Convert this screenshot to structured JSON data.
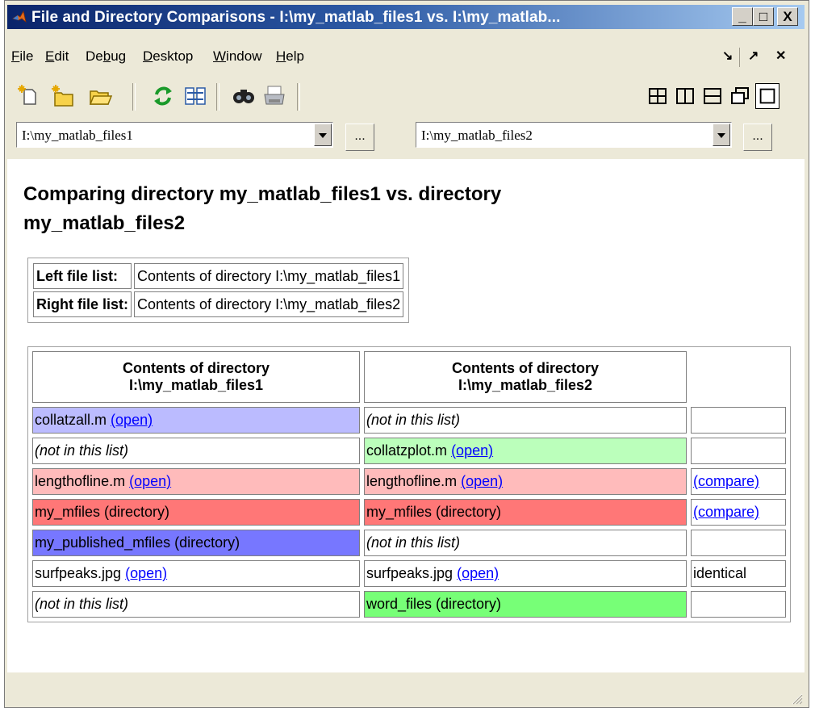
{
  "window": {
    "title": "File and Directory Comparisons - I:\\my_matlab_files1 vs. I:\\my_matlab...",
    "controls": [
      "_",
      "□",
      "X"
    ]
  },
  "menu": {
    "items": [
      "File",
      "Edit",
      "Debug",
      "Desktop",
      "Window",
      "Help"
    ],
    "underline_keys": [
      "F",
      "E",
      "b",
      "D",
      "W",
      "H"
    ],
    "dock_glyph": "↘",
    "undock_glyph": "↗",
    "close_glyph": "✕"
  },
  "toolbar": {
    "icons": [
      "new-file-icon",
      "new-folder-icon",
      "open-folder-icon",
      "refresh-icon",
      "swap-sides-icon",
      "find-icon",
      "print-icon"
    ],
    "layout_icons": [
      "tile-grid-icon",
      "tile-columns-icon",
      "tile-rows-icon",
      "float-icon",
      "maximize-icon"
    ]
  },
  "paths": {
    "left": "I:\\my_matlab_files1",
    "right": "I:\\my_matlab_files2",
    "browse_label": "..."
  },
  "report": {
    "heading": "Comparing directory my_matlab_files1 vs. directory my_matlab_files2",
    "legend": [
      {
        "label": "Left file list:",
        "value": "Contents of directory I:\\my_matlab_files1"
      },
      {
        "label": "Right file list:",
        "value": "Contents of directory I:\\my_matlab_files2"
      }
    ],
    "columns": {
      "left_line1": "Contents of directory",
      "left_line2": "I:\\my_matlab_files1",
      "right_line1": "Contents of directory",
      "right_line2": "I:\\my_matlab_files2"
    },
    "rows": [
      {
        "left": "collatzall.m",
        "left_link": "(open)",
        "left_color": "#bbbbff",
        "right": "(not in this list)",
        "right_link": "",
        "right_color": "#ffffff",
        "action": ""
      },
      {
        "left": "(not in this list)",
        "left_link": "",
        "left_color": "#ffffff",
        "right": "collatzplot.m",
        "right_link": "(open)",
        "right_color": "#bbffbb",
        "action": ""
      },
      {
        "left": "lengthofline.m",
        "left_link": "(open)",
        "left_color": "#ffbbbb",
        "right": "lengthofline.m",
        "right_link": "(open)",
        "right_color": "#ffbbbb",
        "action": "(compare)"
      },
      {
        "left": "my_mfiles (directory)",
        "left_link": "",
        "left_color": "#ff7777",
        "right": "my_mfiles (directory)",
        "right_link": "",
        "right_color": "#ff7777",
        "action": "(compare)"
      },
      {
        "left": "my_published_mfiles (directory)",
        "left_link": "",
        "left_color": "#7777ff",
        "right": "(not in this list)",
        "right_link": "",
        "right_color": "#ffffff",
        "action": ""
      },
      {
        "left": "surfpeaks.jpg",
        "left_link": "(open)",
        "left_color": "#ffffff",
        "right": "surfpeaks.jpg",
        "right_link": "(open)",
        "right_color": "#ffffff",
        "action": "identical"
      },
      {
        "left": "(not in this list)",
        "left_link": "",
        "left_color": "#ffffff",
        "right": "word_files (directory)",
        "right_link": "",
        "right_color": "#77ff77",
        "action": ""
      }
    ]
  }
}
